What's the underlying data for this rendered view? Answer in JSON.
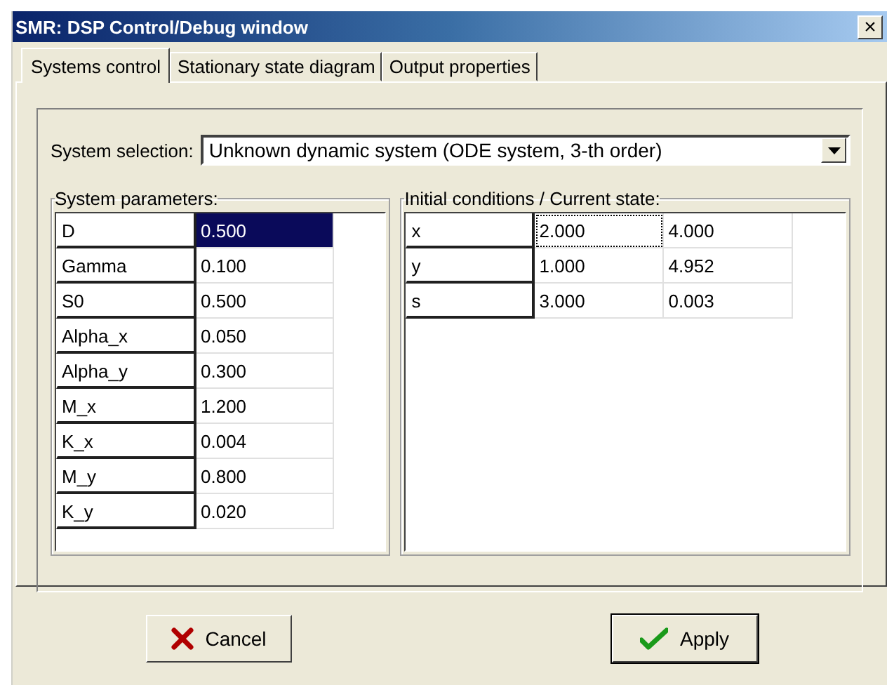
{
  "window": {
    "title": "SMR: DSP Control/Debug window",
    "close": "×"
  },
  "tabs": [
    {
      "label": "Systems control",
      "selected": true
    },
    {
      "label": "Stationary state diagram",
      "selected": false
    },
    {
      "label": "Output properties",
      "selected": false
    }
  ],
  "system_selection": {
    "label": "System selection:",
    "value": "Unknown dynamic system (ODE system,  3-th order)"
  },
  "parameters": {
    "title": "System parameters:",
    "rows": [
      {
        "name": "D",
        "value": "0.500",
        "selected": true
      },
      {
        "name": "Gamma",
        "value": "0.100",
        "selected": false
      },
      {
        "name": "S0",
        "value": "0.500",
        "selected": false
      },
      {
        "name": "Alpha_x",
        "value": "0.050",
        "selected": false
      },
      {
        "name": "Alpha_y",
        "value": "0.300",
        "selected": false
      },
      {
        "name": "M_x",
        "value": "1.200",
        "selected": false
      },
      {
        "name": "K_x",
        "value": "0.004",
        "selected": false
      },
      {
        "name": "M_y",
        "value": "0.800",
        "selected": false
      },
      {
        "name": "K_y",
        "value": "0.020",
        "selected": false
      }
    ]
  },
  "state": {
    "title": "Initial conditions / Current state:",
    "rows": [
      {
        "name": "x",
        "initial": "2.000",
        "current": "4.000",
        "focused": true
      },
      {
        "name": "y",
        "initial": "1.000",
        "current": "4.952",
        "focused": false
      },
      {
        "name": "s",
        "initial": "3.000",
        "current": "0.003",
        "focused": false
      }
    ]
  },
  "buttons": [
    {
      "label": "Cancel",
      "kind": "cancel"
    },
    {
      "label": "Apply",
      "kind": "apply"
    }
  ]
}
